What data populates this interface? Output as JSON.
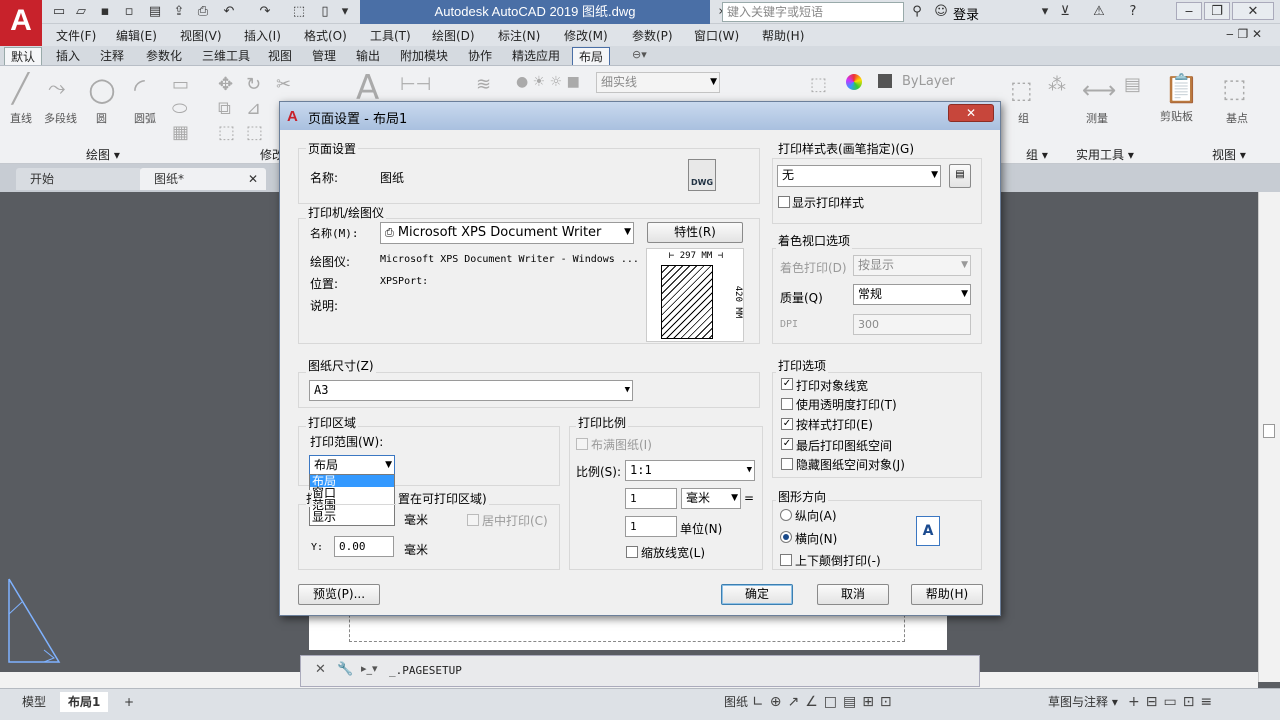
{
  "app": {
    "logo_text": "A",
    "title": "Autodesk AutoCAD 2019    图纸.dwg",
    "search_placeholder": "键入关键字或短语",
    "login_label": "登录"
  },
  "menu": [
    "文件(F)",
    "编辑(E)",
    "视图(V)",
    "插入(I)",
    "格式(O)",
    "工具(T)",
    "绘图(D)",
    "标注(N)",
    "修改(M)",
    "参数(P)",
    "窗口(W)",
    "帮助(H)"
  ],
  "ribbon_tabs": [
    "默认",
    "插入",
    "注释",
    "参数化",
    "三维工具",
    "视图",
    "管理",
    "输出",
    "附加模块",
    "协作",
    "精选应用",
    "布局"
  ],
  "ribbon": {
    "tools": [
      "直线",
      "多段线",
      "圆",
      "圆弧"
    ],
    "panels": [
      "绘图 ▾",
      "修改",
      "组 ▾",
      "实用工具 ▾",
      "视图 ▾"
    ],
    "layer_value": "细实线",
    "bylayer": "ByLayer",
    "group_label": "组",
    "measure_label": "测量",
    "clipboard_label": "剪贴板",
    "base_label": "基点"
  },
  "doc_tabs": [
    "开始",
    "图纸*"
  ],
  "layout_tabs": [
    "模型",
    "布局1"
  ],
  "command_line": "_.PAGESETUP",
  "status": {
    "paper_label": "图纸",
    "workspace_label": "草图与注释 ▾"
  },
  "dialog": {
    "title": "页面设置 - 布局1",
    "page_setup": {
      "group_title": "页面设置",
      "name_label": "名称:",
      "name_value": "图纸",
      "dwg_icon_text": "DWG"
    },
    "printer": {
      "group_title": "打印机/绘图仪",
      "name_label": "名称(M):",
      "name_value": "Microsoft XPS Document Writer",
      "properties_button": "特性(R)",
      "plotter_label": "绘图仪:",
      "plotter_value": "Microsoft XPS Document Writer - Windows ...",
      "location_label": "位置:",
      "location_value": "XPSPort:",
      "description_label": "说明:",
      "preview_width": "297 MM",
      "preview_height": "420 MM"
    },
    "paper_size": {
      "group_title": "图纸尺寸(Z)",
      "value": "A3"
    },
    "plot_area": {
      "group_title": "打印区域",
      "range_label": "打印范围(W):",
      "selected": "布局",
      "options": [
        "布局",
        "窗口",
        "范围",
        "显示"
      ]
    },
    "plot_offset": {
      "group_title_visible": "置在可打印区域)",
      "x_unit": "毫米",
      "y_label": "Y:",
      "y_value": "0.00",
      "y_unit": "毫米",
      "center_label": "居中打印(C)"
    },
    "plot_scale": {
      "group_title": "打印比例",
      "fit_paper": "布满图纸(I)",
      "scale_label": "比例(S):",
      "scale_value": "1:1",
      "value1": "1",
      "unit_value": "毫米",
      "equals": "=",
      "value2": "1",
      "unit2_label": "单位(N)",
      "scale_lineweights": "缩放线宽(L)"
    },
    "plot_style_table": {
      "group_title": "打印样式表(画笔指定)(G)",
      "value": "无",
      "show_styles": "显示打印样式"
    },
    "shaded_viewport": {
      "group_title": "着色视口选项",
      "shade_label": "着色打印(D)",
      "shade_value": "按显示",
      "quality_label": "质量(Q)",
      "quality_value": "常规",
      "dpi_label": "DPI",
      "dpi_value": "300"
    },
    "plot_options": {
      "group_title": "打印选项",
      "items": [
        {
          "label": "打印对象线宽",
          "checked": true
        },
        {
          "label": "使用透明度打印(T)",
          "checked": false
        },
        {
          "label": "按样式打印(E)",
          "checked": true
        },
        {
          "label": "最后打印图纸空间",
          "checked": true
        },
        {
          "label": "隐藏图纸空间对象(J)",
          "checked": false
        }
      ]
    },
    "orientation": {
      "group_title": "图形方向",
      "portrait": "纵向(A)",
      "landscape": "横向(N)",
      "upside_down": "上下颠倒打印(-)",
      "selected": "landscape"
    },
    "buttons": {
      "preview": "预览(P)...",
      "ok": "确定",
      "cancel": "取消",
      "help": "帮助(H)"
    }
  },
  "colors": {
    "accent": "#c8222b",
    "dialog_title": "#b9cde8",
    "selection": "#3399ff",
    "canvas": "#595c61"
  }
}
